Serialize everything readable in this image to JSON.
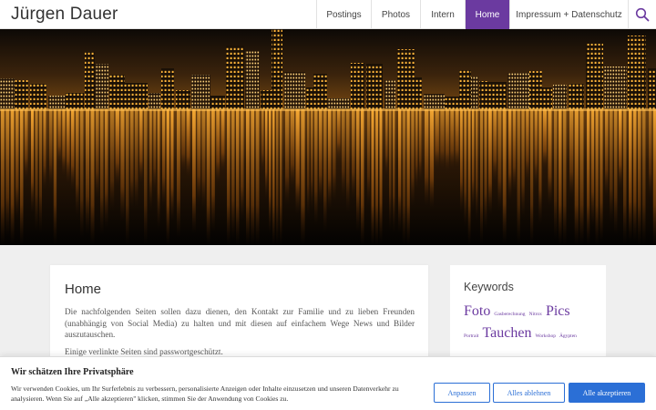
{
  "header": {
    "site_title": "Jürgen Dauer",
    "nav": [
      {
        "label": "Postings"
      },
      {
        "label": "Photos"
      },
      {
        "label": "Intern"
      },
      {
        "label": "Home",
        "active": true
      },
      {
        "label": "Impressum + Datenschutz"
      }
    ],
    "search_icon": "search-icon"
  },
  "hero": {
    "image_description": "night city skyline reflected in water"
  },
  "main": {
    "title": "Home",
    "paragraphs": [
      "Die nachfolgenden Seiten sollen dazu dienen, den Kontakt zur Familie und zu lieben Freunden (unabhängig von Social Media) zu halten und mit diesen auf einfachem Wege News und Bilder auszutauschen.",
      "Einige verlinkte Seiten sind passwortgeschützt."
    ]
  },
  "sidebar": {
    "title": "Keywords",
    "tags": [
      {
        "label": "Foto",
        "size": "big"
      },
      {
        "label": "Gasberechnung",
        "size": "small"
      },
      {
        "label": "Nitrox",
        "size": "small"
      },
      {
        "label": "Pics",
        "size": "big"
      },
      {
        "label": "Portrait",
        "size": "small"
      },
      {
        "label": "Tauchen",
        "size": "big"
      },
      {
        "label": "Workshop",
        "size": "small"
      },
      {
        "label": "Ägypten",
        "size": "small"
      }
    ]
  },
  "cookie": {
    "title": "Wir schätzen Ihre Privatsphäre",
    "text": "Wir verwenden Cookies, um Ihr Surferlebnis zu verbessern, personalisierte Anzeigen oder Inhalte einzusetzen und unseren Datenverkehr zu analysieren. Wenn Sie auf „Alle akzeptieren\" klicken, stimmen Sie der Anwendung von Cookies zu.",
    "buttons": {
      "customize": "Anpassen",
      "reject": "Alles ablehnen",
      "accept": "Alle akzeptieren"
    }
  },
  "colors": {
    "accent": "#6b3aa0",
    "button_blue": "#2b6fd6"
  }
}
